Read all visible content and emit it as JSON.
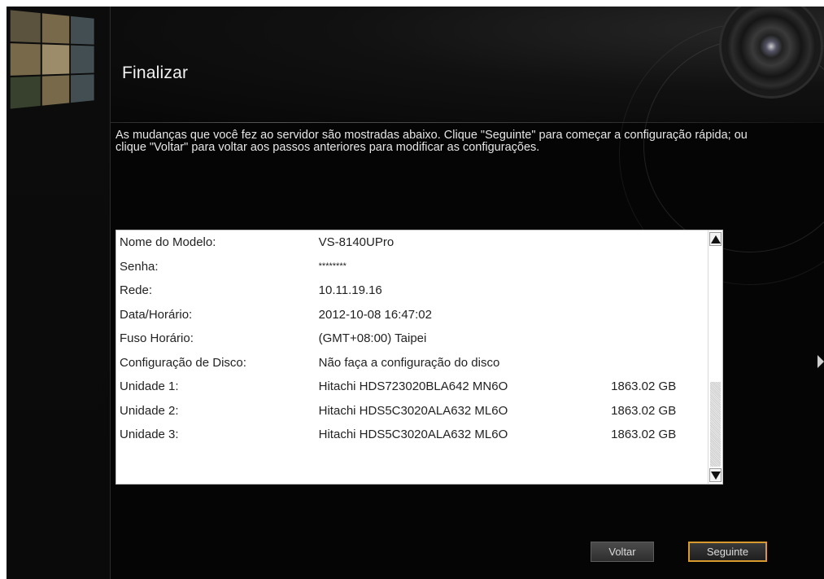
{
  "header": {
    "title": "Finalizar"
  },
  "description": "As mudanças que você fez ao servidor são mostradas abaixo. Clique \"Seguinte\" para começar a configuração rápida; ou clique \"Voltar\" para voltar aos passos anteriores para modificar as configurações.",
  "summary": {
    "rows": [
      {
        "label": "Nome do Modelo:",
        "value": "VS-8140UPro",
        "size": ""
      },
      {
        "label": "Senha:",
        "value": "********",
        "size": ""
      },
      {
        "label": "Rede:",
        "value": "10.11.19.16",
        "size": ""
      },
      {
        "label": "Data/Horário:",
        "value": "2012-10-08 16:47:02",
        "size": ""
      },
      {
        "label": "Fuso Horário:",
        "value": "(GMT+08:00) Taipei",
        "size": ""
      },
      {
        "label": "Configuração de Disco:",
        "value": "Não faça a configuração do disco",
        "size": ""
      },
      {
        "label": "Unidade 1:",
        "value": "Hitachi HDS723020BLA642 MN6O",
        "size": "1863.02 GB"
      },
      {
        "label": "Unidade 2:",
        "value": "Hitachi HDS5C3020ALA632 ML6O",
        "size": "1863.02 GB"
      },
      {
        "label": "Unidade 3:",
        "value": "Hitachi HDS5C3020ALA632 ML6O",
        "size": "1863.02 GB"
      }
    ]
  },
  "buttons": {
    "back_label": "Voltar",
    "next_label": "Seguinte"
  },
  "colors": {
    "accent_border": "#d89a2c",
    "background": "#050505"
  }
}
